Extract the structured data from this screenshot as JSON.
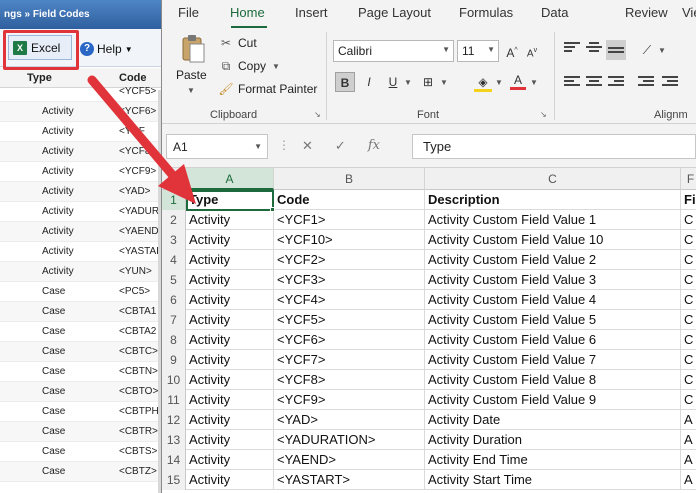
{
  "left_app": {
    "title": "ngs » Field Codes",
    "excel_button": "Excel",
    "help_button": "Help",
    "columns": {
      "type": "Type",
      "code": "Code"
    },
    "rows": [
      {
        "type": "",
        "code": "<YCF5>"
      },
      {
        "type": "Activity",
        "code": "<YCF6>"
      },
      {
        "type": "Activity",
        "code": "<YCF"
      },
      {
        "type": "Activity",
        "code": "<YCF8>"
      },
      {
        "type": "Activity",
        "code": "<YCF9>"
      },
      {
        "type": "Activity",
        "code": "<YAD>"
      },
      {
        "type": "Activity",
        "code": "<YADUR"
      },
      {
        "type": "Activity",
        "code": "<YAEND"
      },
      {
        "type": "Activity",
        "code": "<YASTAI"
      },
      {
        "type": "Activity",
        "code": "<YUN>"
      },
      {
        "type": "Case",
        "code": "<PC5>"
      },
      {
        "type": "Case",
        "code": "<CBTA1"
      },
      {
        "type": "Case",
        "code": "<CBTA2"
      },
      {
        "type": "Case",
        "code": "<CBTC>"
      },
      {
        "type": "Case",
        "code": "<CBTN>"
      },
      {
        "type": "Case",
        "code": "<CBTO>"
      },
      {
        "type": "Case",
        "code": "<CBTPH"
      },
      {
        "type": "Case",
        "code": "<CBTR>"
      },
      {
        "type": "Case",
        "code": "<CBTS>"
      },
      {
        "type": "Case",
        "code": "<CBTZ>"
      }
    ]
  },
  "excel": {
    "tabs": [
      "File",
      "Home",
      "Insert",
      "Page Layout",
      "Formulas",
      "Data",
      "Review",
      "View"
    ],
    "active_tab": "Home",
    "clipboard": {
      "paste": "Paste",
      "cut": "Cut",
      "copy": "Copy",
      "format_painter": "Format Painter",
      "label": "Clipboard"
    },
    "font": {
      "name": "Calibri",
      "size": "11",
      "bold": "B",
      "italic": "I",
      "underline": "U",
      "label": "Font"
    },
    "alignment_label": "Alignm",
    "name_box": "A1",
    "fx_symbol": "fx",
    "formula_value": "Type",
    "column_headers": [
      "A",
      "B",
      "C",
      "F"
    ],
    "rows": [
      {
        "num": "1",
        "a": "Type",
        "b": "Code",
        "c": "Description",
        "d": "Fi"
      },
      {
        "num": "2",
        "a": "Activity",
        "b": "<YCF1>",
        "c": "Activity Custom Field Value 1",
        "d": "C"
      },
      {
        "num": "3",
        "a": "Activity",
        "b": "<YCF10>",
        "c": "Activity Custom Field Value 10",
        "d": "C"
      },
      {
        "num": "4",
        "a": "Activity",
        "b": "<YCF2>",
        "c": "Activity Custom Field Value 2",
        "d": "C"
      },
      {
        "num": "5",
        "a": "Activity",
        "b": "<YCF3>",
        "c": "Activity Custom Field Value 3",
        "d": "C"
      },
      {
        "num": "6",
        "a": "Activity",
        "b": "<YCF4>",
        "c": "Activity Custom Field Value 4",
        "d": "C"
      },
      {
        "num": "7",
        "a": "Activity",
        "b": "<YCF5>",
        "c": "Activity Custom Field Value 5",
        "d": "C"
      },
      {
        "num": "8",
        "a": "Activity",
        "b": "<YCF6>",
        "c": "Activity Custom Field Value 6",
        "d": "C"
      },
      {
        "num": "9",
        "a": "Activity",
        "b": "<YCF7>",
        "c": "Activity Custom Field Value 7",
        "d": "C"
      },
      {
        "num": "10",
        "a": "Activity",
        "b": "<YCF8>",
        "c": "Activity Custom Field Value 8",
        "d": "C"
      },
      {
        "num": "11",
        "a": "Activity",
        "b": "<YCF9>",
        "c": "Activity Custom Field Value 9",
        "d": "C"
      },
      {
        "num": "12",
        "a": "Activity",
        "b": "<YAD>",
        "c": "Activity Date",
        "d": "A"
      },
      {
        "num": "13",
        "a": "Activity",
        "b": "<YADURATION>",
        "c": "Activity Duration",
        "d": "A"
      },
      {
        "num": "14",
        "a": "Activity",
        "b": "<YAEND>",
        "c": "Activity End Time",
        "d": "A"
      },
      {
        "num": "15",
        "a": "Activity",
        "b": "<YASTART>",
        "c": "Activity Start Time",
        "d": "A"
      }
    ]
  },
  "colors": {
    "excel_green": "#1d6b3c",
    "callout_red": "#e0343a",
    "left_title_blue": "#2f5f9e"
  }
}
